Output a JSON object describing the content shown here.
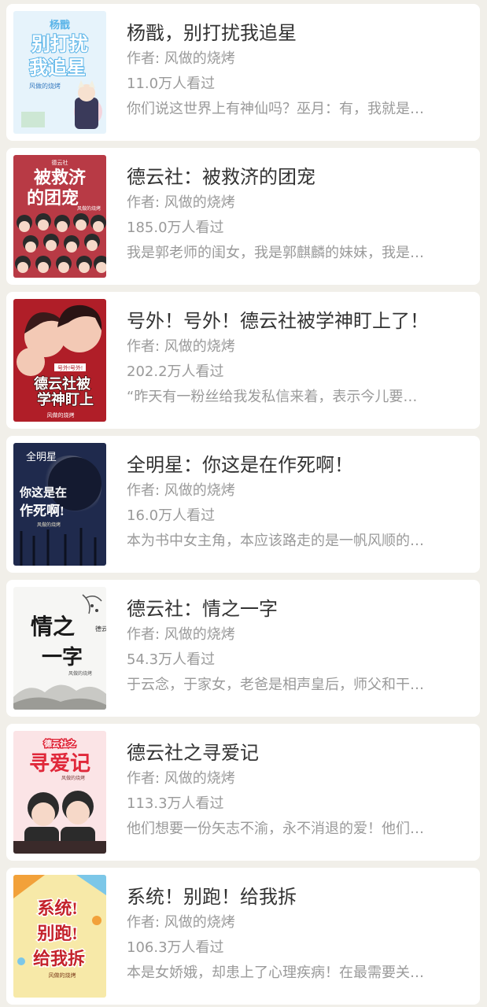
{
  "books": [
    {
      "title": "杨戬，别打扰我追星",
      "author": "作者: 风做的烧烤",
      "views": "11.0万人看过",
      "desc": "你们说这世界上有神仙吗？巫月：有，我就是…",
      "cover": {
        "bg": "#e6f3fb",
        "accent": "#5ab4e8",
        "text_color": "#ffffff",
        "lines": [
          "杨戬",
          "别打扰",
          "我追星"
        ],
        "small": "风做的烧烤"
      }
    },
    {
      "title": "德云社：被救济的团宠",
      "author": "作者: 风做的烧烤",
      "views": "185.0万人看过",
      "desc": "我是郭老师的闺女，我是郭麒麟的妹妹，我是…",
      "cover": {
        "bg": "#b83a45",
        "accent": "#2a2a2a",
        "text_color": "#ffffff",
        "lines": [
          "德云社",
          "被救济",
          "的团宠"
        ],
        "small": "风做的烧烤"
      }
    },
    {
      "title": "号外！号外！德云社被学神盯上了！",
      "author": "作者: 风做的烧烤",
      "views": "202.2万人看过",
      "desc": "“昨天有一粉丝给我发私信来着，表示今儿要…",
      "cover": {
        "bg": "#b01e28",
        "accent": "#f3c9b5",
        "text_color": "#ffffff",
        "lines": [
          "号外!号外!",
          "德云社被",
          "学神盯上"
        ],
        "small": "风做的烧烤"
      }
    },
    {
      "title": "全明星：你这是在作死啊！",
      "author": "作者: 风做的烧烤",
      "views": "16.0万人看过",
      "desc": "本为书中女主角，本应该路走的是一帆风顺的…",
      "cover": {
        "bg": "#1f2a4d",
        "accent": "#e8e0c8",
        "text_color": "#ffffff",
        "lines": [
          "全明星",
          "你这是在",
          "作死啊!"
        ],
        "small": "风做的烧烤"
      }
    },
    {
      "title": "德云社：情之一字",
      "author": "作者: 风做的烧烤",
      "views": "54.3万人看过",
      "desc": "于云念，于家女，老爸是相声皇后，师父和干…",
      "cover": {
        "bg": "#f6f6f4",
        "accent": "#6b6b6b",
        "text_color": "#1a1a1a",
        "lines": [
          "德云社",
          "情之",
          "一字"
        ],
        "small": "风做的烧烤"
      }
    },
    {
      "title": "德云社之寻爱记",
      "author": "作者: 风做的烧烤",
      "views": "113.3万人看过",
      "desc": "他们想要一份矢志不渝，永不消退的爱！他们…",
      "cover": {
        "bg": "#fbe4e6",
        "accent": "#2b2b2b",
        "text_color": "#e0283a",
        "lines": [
          "德云社之",
          "寻爱记"
        ],
        "small": "风做的烧烤"
      }
    },
    {
      "title": "系统！别跑！给我拆",
      "author": "作者: 风做的烧烤",
      "views": "106.3万人看过",
      "desc": "本是女娇娥，却患上了心理疾病！在最需要关…",
      "cover": {
        "bg": "#f7e9a8",
        "accent": "#f2a13a",
        "text_color": "#c4222b",
        "lines": [
          "系统!",
          "别跑!",
          "给我拆"
        ],
        "small": "风做的烧烤"
      }
    }
  ]
}
